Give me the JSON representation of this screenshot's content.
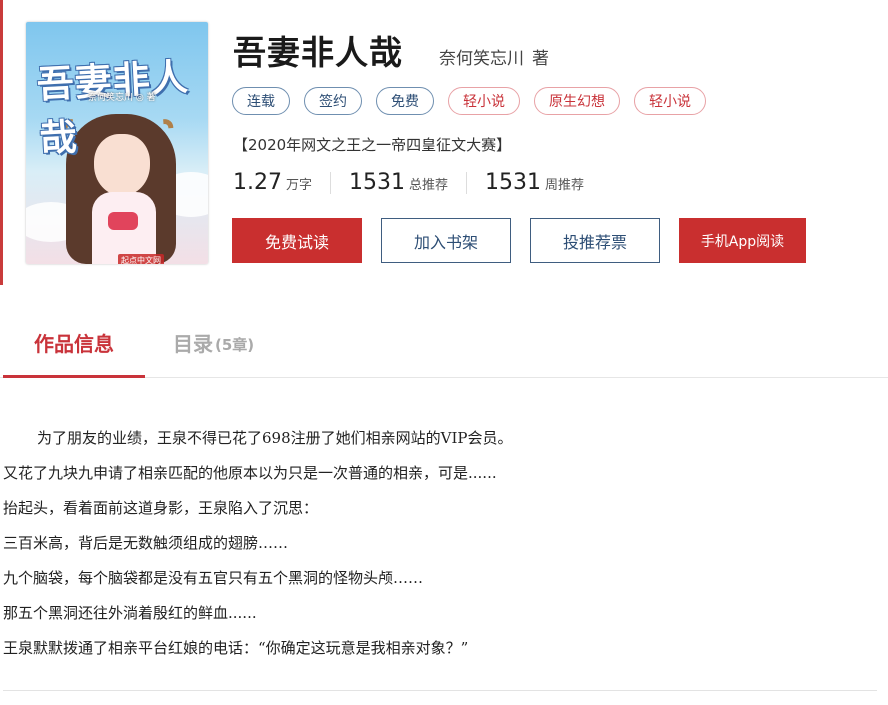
{
  "cover": {
    "title": "吾妻非人哉",
    "author": "奈何笑忘川 ◎ 著",
    "publisher_logo": "起点中文网"
  },
  "book": {
    "title": "吾妻非人哉",
    "author": "奈何笑忘川",
    "author_suffix": "著"
  },
  "tags": [
    {
      "label": "连载",
      "style": "blue"
    },
    {
      "label": "签约",
      "style": "blue"
    },
    {
      "label": "免费",
      "style": "blue"
    },
    {
      "label": "轻小说",
      "style": "red"
    },
    {
      "label": "原生幻想",
      "style": "red"
    },
    {
      "label": "轻小说",
      "style": "red"
    }
  ],
  "contest": "【2020年网文之王之一帝四皇征文大赛】",
  "stats": [
    {
      "value": "1.27",
      "unit": "万字"
    },
    {
      "value": "1531",
      "unit": "总推荐"
    },
    {
      "value": "1531",
      "unit": "周推荐"
    }
  ],
  "buttons": {
    "free_trial": "免费试读",
    "add_shelf": "加入书架",
    "vote": "投推荐票",
    "app_read": "手机App阅读"
  },
  "tabs": {
    "info": "作品信息",
    "toc": "目录",
    "toc_count": "(5章)"
  },
  "description": [
    "为了朋友的业绩，王泉不得已花了698注册了她们相亲网站的VIP会员。",
    "又花了九块九申请了相亲匹配的他原本以为只是一次普通的相亲，可是......",
    "抬起头，看着面前这道身影，王泉陷入了沉思：",
    "三百米高，背后是无数触须组成的翅膀……",
    "九个脑袋，每个脑袋都是没有五官只有五个黑洞的怪物头颅……",
    "那五个黑洞还往外淌着殷红的鲜血......",
    "王泉默默拨通了相亲平台红娘的电话：“你确定这玩意是我相亲对象？”"
  ],
  "colors": {
    "accent": "#c92f2f",
    "tag_blue": "#2d4e75",
    "tag_red": "#c9333a"
  }
}
